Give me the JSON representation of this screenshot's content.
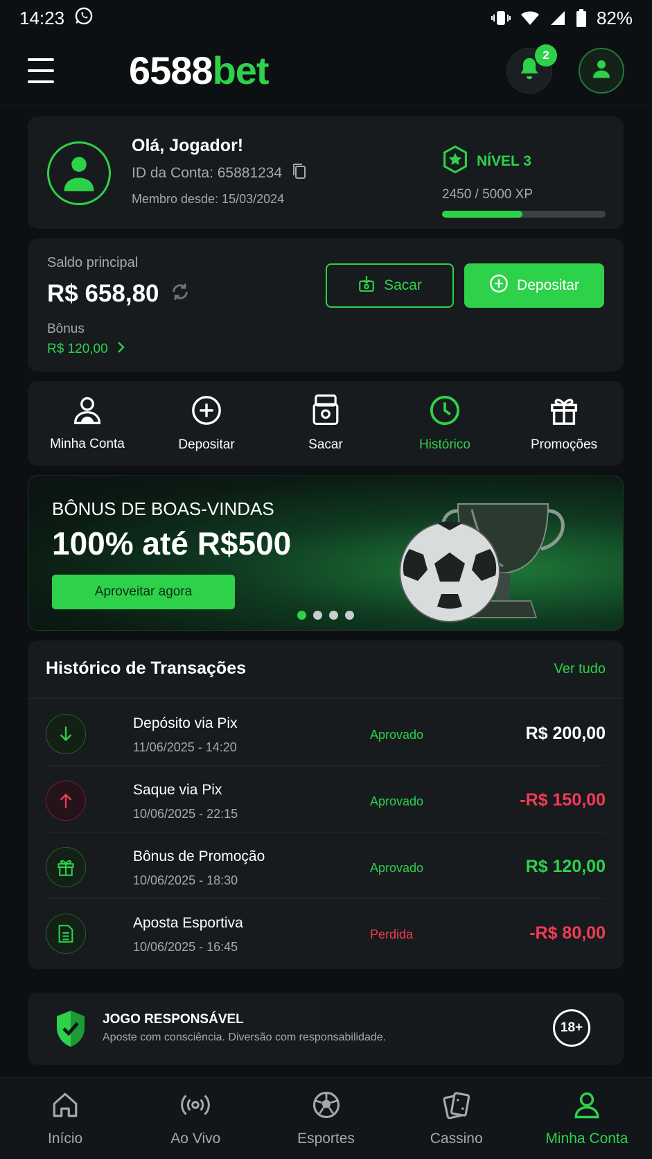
{
  "status_bar": {
    "time": "14:23",
    "battery": "82%"
  },
  "header": {
    "logo_number": "6588",
    "logo_suffix": "bet",
    "notification_count": "2"
  },
  "profile": {
    "greeting": "Olá, Jogador!",
    "account_id": "ID da Conta: 65881234",
    "member_since": "Membro desde: 15/03/2024",
    "level": "NÍVEL 3",
    "xp_text": "2450 / 5000 XP",
    "xp_progress": 0.49
  },
  "balance": {
    "label": "Saldo principal",
    "value": "R$ 658,80",
    "bonus_label": "Bônus",
    "bonus_value": "R$ 120,00",
    "withdraw_label": "Sacar",
    "deposit_label": "Depositar"
  },
  "quick_actions": [
    {
      "label": "Minha Conta",
      "icon": "user-icon"
    },
    {
      "label": "Depositar",
      "icon": "plus-circle-icon"
    },
    {
      "label": "Sacar",
      "icon": "withdraw-icon"
    },
    {
      "label": "Histórico",
      "icon": "clock-icon"
    },
    {
      "label": "Promoções",
      "icon": "gift-icon"
    }
  ],
  "banner": {
    "subtitle": "BÔNUS DE BOAS-VINDAS",
    "title": "100% até R$500",
    "cta": "Aproveitar agora"
  },
  "transactions": {
    "title": "Histórico de Transações",
    "view_all": "Ver tudo",
    "items": [
      {
        "name": "Depósito via Pix",
        "date": "11/06/2025 - 14:20",
        "status": "Aprovado",
        "amount": "R$ 200,00",
        "icon": "arrow-down-icon"
      },
      {
        "name": "Saque via Pix",
        "date": "10/06/2025 - 22:15",
        "status": "Aprovado",
        "amount": "-R$ 150,00",
        "icon": "arrow-up-icon"
      },
      {
        "name": "Bônus de Promoção",
        "date": "10/06/2025 - 18:30",
        "status": "Aprovado",
        "amount": "R$ 120,00",
        "icon": "gift-icon"
      },
      {
        "name": "Aposta Esportiva",
        "date": "10/06/2025 - 16:45",
        "status": "Perdida",
        "amount": "-R$ 80,00",
        "icon": "document-icon"
      }
    ]
  },
  "responsible": {
    "title": "JOGO RESPONSÁVEL",
    "text": "Aposte com consciência. Diversão com responsabilidade.",
    "age": "18+"
  },
  "bottom_nav": [
    {
      "label": "Início",
      "icon": "home-icon"
    },
    {
      "label": "Ao Vivo",
      "icon": "live-icon"
    },
    {
      "label": "Esportes",
      "icon": "soccer-ball-icon"
    },
    {
      "label": "Cassino",
      "icon": "cards-icon"
    },
    {
      "label": "Minha Conta",
      "icon": "user-icon"
    }
  ],
  "colors": {
    "accent": "#2ed24a",
    "negative": "#f23b55",
    "background": "#0d1012",
    "card": "#171b1e"
  }
}
